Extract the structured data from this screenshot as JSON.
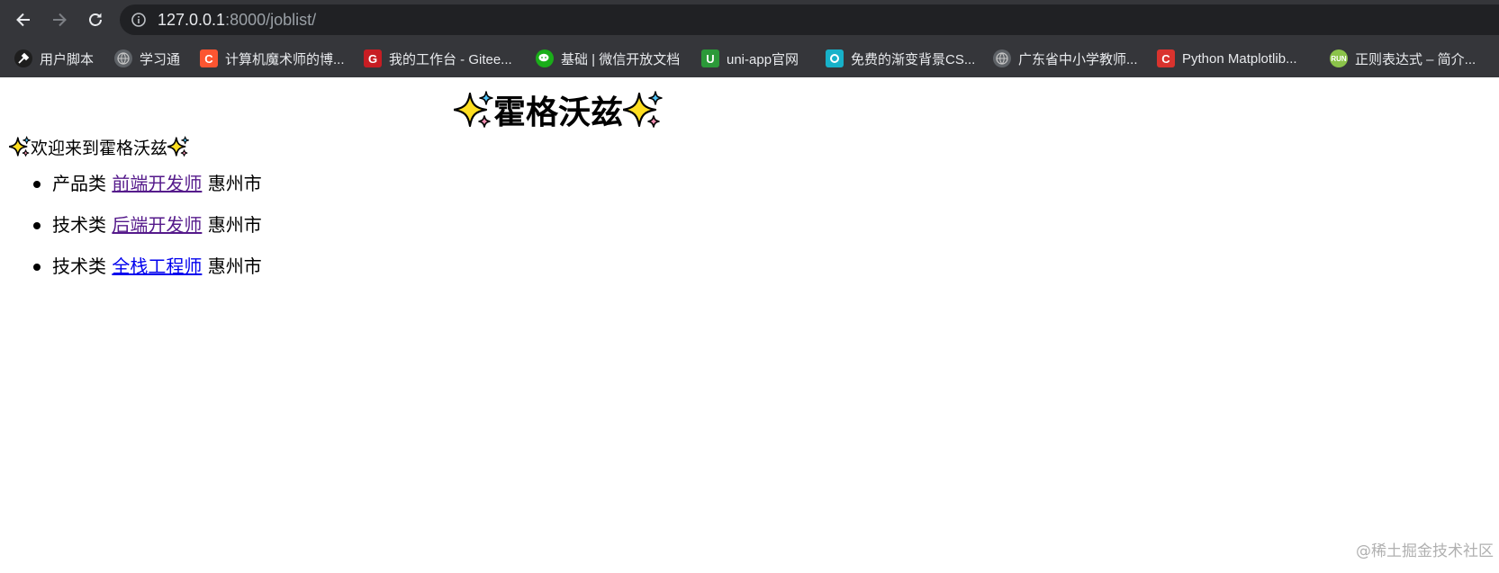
{
  "browser": {
    "url_host": "127.0.0.1",
    "url_rest": ":8000/joblist/",
    "bookmarks": [
      {
        "label": "用户脚本",
        "icon": "script-icon"
      },
      {
        "label": "学习通",
        "icon": "globe-icon"
      },
      {
        "label": "计算机魔术师的博...",
        "icon": "csdn-icon",
        "glyph": "C"
      },
      {
        "label": "我的工作台 - Gitee...",
        "icon": "gitee-icon",
        "glyph": "G"
      },
      {
        "label": "基础 | 微信开放文档",
        "icon": "wechat-icon"
      },
      {
        "label": "uni-app官网",
        "icon": "uniapp-icon",
        "glyph": "U"
      },
      {
        "label": "免费的渐变背景CS...",
        "icon": "gradient-icon"
      },
      {
        "label": "广东省中小学教师...",
        "icon": "globe-icon"
      },
      {
        "label": "Python Matplotlib...",
        "icon": "csdn-icon",
        "glyph": "C"
      },
      {
        "label": "正则表达式 – 简介...",
        "icon": "runoob-icon",
        "glyph": "RUN"
      }
    ]
  },
  "page": {
    "title": "霍格沃兹",
    "welcome": "欢迎来到霍格沃兹",
    "jobs": [
      {
        "category": "产品类",
        "title": "前端开发师",
        "city": "惠州市",
        "visited": true
      },
      {
        "category": "技术类",
        "title": "后端开发师",
        "city": "惠州市",
        "visited": true
      },
      {
        "category": "技术类",
        "title": "全栈工程师",
        "city": "惠州市",
        "visited": false
      }
    ]
  },
  "watermark": "@稀土掘金技术社区",
  "colors": {
    "chrome_bg": "#35363a",
    "omnibox_bg": "#202124",
    "link_visited": "#551a8b",
    "link_unvisited": "#0000ee"
  }
}
